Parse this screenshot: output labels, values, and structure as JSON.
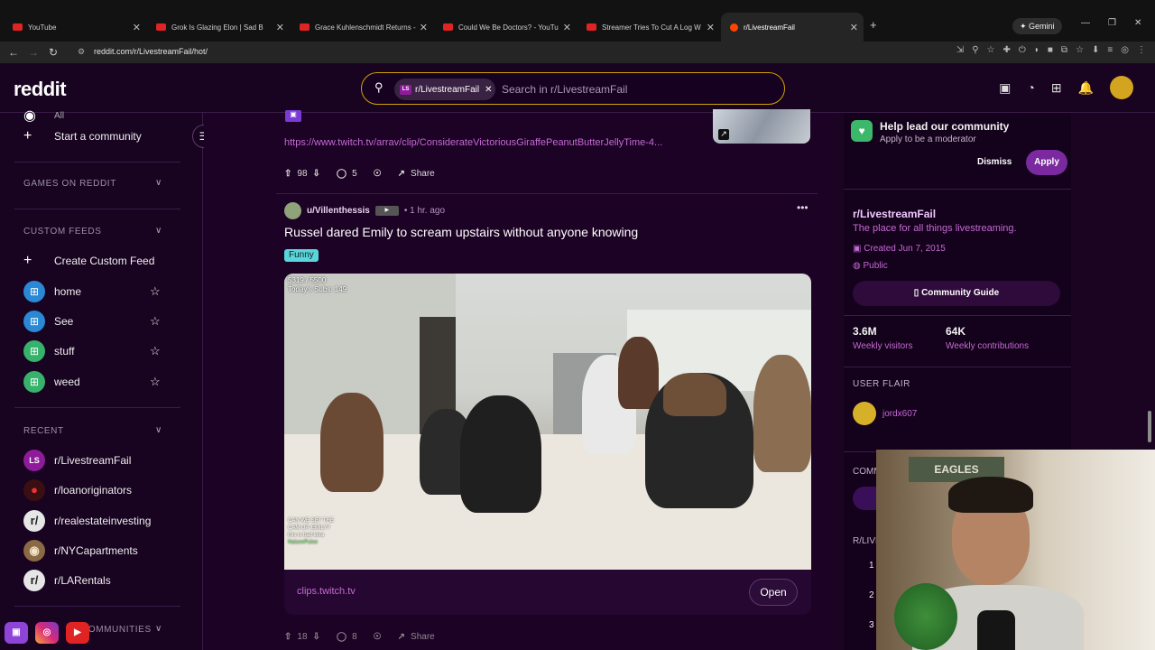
{
  "browser": {
    "tabs": [
      {
        "title": "YouTube"
      },
      {
        "title": "Grok Is Glazing Elon | Sad B"
      },
      {
        "title": "Grace Kuhlenschmidt Returns -"
      },
      {
        "title": "Could We Be Doctors? - YouTu"
      },
      {
        "title": "Streamer Tries To Cut A Log W"
      },
      {
        "title": "r/LivestreamFail"
      }
    ],
    "new_tab": "+",
    "gemini": "Gemini",
    "url": "reddit.com/r/LivestreamFail/hot/"
  },
  "header": {
    "logo": "reddit",
    "search_chip": "r/LivestreamFail",
    "search_chip_icon": "LS",
    "search_placeholder": "Search in r/LivestreamFail"
  },
  "sidebar": {
    "partial_label": "All",
    "start_community": "Start a community",
    "games_section": "GAMES ON REDDIT",
    "custom_feeds_section": "CUSTOM FEEDS",
    "create_feed": "Create Custom Feed",
    "feeds": [
      {
        "label": "home"
      },
      {
        "label": "See"
      },
      {
        "label": "stuff"
      },
      {
        "label": "weed"
      }
    ],
    "recent_section": "RECENT",
    "recent": [
      {
        "label": "r/LivestreamFail",
        "icon": "LS"
      },
      {
        "label": "r/loanoriginators",
        "icon": "●"
      },
      {
        "label": "r/realestateinvesting",
        "icon": "r/"
      },
      {
        "label": "r/NYCapartments",
        "icon": "◉"
      },
      {
        "label": "r/LARentals",
        "icon": "r/"
      }
    ],
    "bottom_section": "COMMUNITIES"
  },
  "post1": {
    "platform_badge": "▣",
    "link": "https://www.twitch.tv/arrav/clip/ConsiderateVictoriousGiraffePeanutButterJellyTime-4...",
    "votes": "98",
    "comments": "5",
    "share": "Share"
  },
  "post2": {
    "author": "u/Villenthessis",
    "time": "1 hr. ago",
    "title": "Russel dared Emily to scream upstairs without anyone knowing",
    "flair": "Funny",
    "overlay_top": "5319 / 5500",
    "overlay_subs": "Today's Subs: 149",
    "chat_lines": [
      "CAN WE SET THE",
      "CAM UP, EMILY?",
      "this is bad idea",
      "NaturePulse"
    ],
    "domain": "clips.twitch.tv",
    "open": "Open",
    "votes": "18",
    "comments": "8",
    "share": "Share"
  },
  "right": {
    "help_title": "Help lead our community",
    "help_sub": "Apply to be a moderator",
    "dismiss": "Dismiss",
    "apply": "Apply",
    "sub_name": "r/LivestreamFail",
    "sub_desc": "The place for all things livestreaming.",
    "created": "Created Jun 7, 2015",
    "visibility": "Public",
    "guide": "Community Guide",
    "visitors": "3.6M",
    "visitors_label": "Weekly visitors",
    "contrib": "64K",
    "contrib_label": "Weekly contributions",
    "user_flair_heading": "USER FLAIR",
    "user_flair": "jordx607",
    "community_heading": "COMM",
    "rules_heading": "R/LIVE",
    "rule_numbers": [
      "1",
      "2",
      "3"
    ]
  },
  "webcam": {
    "poster": "EAGLES"
  },
  "colors": {
    "accent": "#7a2a9e",
    "background": "#1c0224",
    "link": "#c56ad4"
  }
}
